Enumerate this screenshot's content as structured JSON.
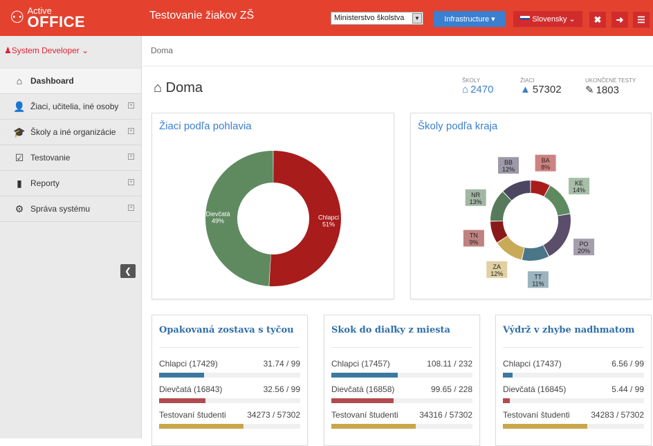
{
  "header": {
    "logo_top": "Active",
    "logo_bottom": "OFFICE",
    "title": "Testovanie žiakov ZŠ",
    "org_select": "Ministerstvo školstva",
    "infra_label": "Infrastructure",
    "lang_label": "Slovensky",
    "expand_icon": "✖",
    "logout_icon": "➜",
    "menu_icon": "☰"
  },
  "sidebar": {
    "user": "System Developer",
    "collapse_icon": "❮",
    "items": [
      {
        "label": "Dashboard",
        "icon": "home-icon",
        "glyph": "⌂",
        "active": true
      },
      {
        "label": "Žiaci, učitelia, iné osoby",
        "icon": "user-icon",
        "glyph": "👤"
      },
      {
        "label": "Školy a iné organizácie",
        "icon": "graduation-cap-icon",
        "glyph": "🎓"
      },
      {
        "label": "Testovanie",
        "icon": "checkbox-icon",
        "glyph": "☑"
      },
      {
        "label": "Reporty",
        "icon": "bar-chart-icon",
        "glyph": "▮"
      },
      {
        "label": "Správa systému",
        "icon": "cogs-icon",
        "glyph": "⚙"
      }
    ]
  },
  "breadcrumb": "Doma",
  "page_title": "Doma",
  "stats": [
    {
      "label": "ŠKOLY",
      "value": "2470",
      "icon": "bank-icon",
      "glyph": "🏛"
    },
    {
      "label": "ŽIACI",
      "value": "57302",
      "icon": "graduation-cap-icon",
      "glyph": "🎓"
    },
    {
      "label": "UKONČENÉ TESTY",
      "value": "1803",
      "icon": "pencil-icon",
      "glyph": "✎"
    }
  ],
  "colors": {
    "red": "#a81c1c",
    "green": "#5f8a60",
    "accent": "#3a7fd0",
    "blue_bar": "#3c78a0",
    "red_bar": "#b34a50",
    "gold_bar": "#c9a64a"
  },
  "chart_data": [
    {
      "type": "pie",
      "title": "Žiaci podľa pohlavia",
      "labels": [
        "Chlapci",
        "Dievčatá"
      ],
      "values": [
        51,
        49
      ],
      "units": "%",
      "colors": [
        "#a81c1c",
        "#5f8a60"
      ]
    },
    {
      "type": "pie",
      "title": "Školy podľa kraja",
      "labels": [
        "BA",
        "KE",
        "PO",
        "TT",
        "ZA",
        "TN",
        "NR",
        "BB"
      ],
      "values": [
        8,
        14,
        20,
        11,
        12,
        9,
        13,
        12
      ],
      "units": "%",
      "colors": [
        "#a81c1c",
        "#5f8a60",
        "#5a4e6a",
        "#4a7688",
        "#c9aa58",
        "#8a1a1a",
        "#567a5a",
        "#4c4660"
      ]
    }
  ],
  "bars": [
    {
      "title": "Opakovaná zostava s tyčou",
      "rows": [
        {
          "label": "Chlapci (17429)",
          "value": "31.74 / 99",
          "fraction": 0.32,
          "color": "#3c78a0"
        },
        {
          "label": "Dievčatá (16843)",
          "value": "32.56 / 99",
          "fraction": 0.33,
          "color": "#b34a50"
        },
        {
          "label": "Testovaní študenti",
          "value": "34273 / 57302",
          "fraction": 0.6,
          "color": "#c9a64a"
        }
      ]
    },
    {
      "title": "Skok do diaľky z miesta",
      "rows": [
        {
          "label": "Chlapci (17457)",
          "value": "108.11 / 232",
          "fraction": 0.47,
          "color": "#3c78a0"
        },
        {
          "label": "Dievčatá (16858)",
          "value": "99.65 / 228",
          "fraction": 0.44,
          "color": "#b34a50"
        },
        {
          "label": "Testovaní študenti",
          "value": "34316 / 57302",
          "fraction": 0.6,
          "color": "#c9a64a"
        }
      ]
    },
    {
      "title": "Výdrž v zhybe nadhmatom",
      "rows": [
        {
          "label": "Chlapci (17437)",
          "value": "6.56 / 99",
          "fraction": 0.07,
          "color": "#3c78a0"
        },
        {
          "label": "Dievčatá (16845)",
          "value": "5.44 / 99",
          "fraction": 0.05,
          "color": "#b34a50"
        },
        {
          "label": "Testovaní študenti",
          "value": "34283 / 57302",
          "fraction": 0.6,
          "color": "#c9a64a"
        }
      ]
    }
  ]
}
